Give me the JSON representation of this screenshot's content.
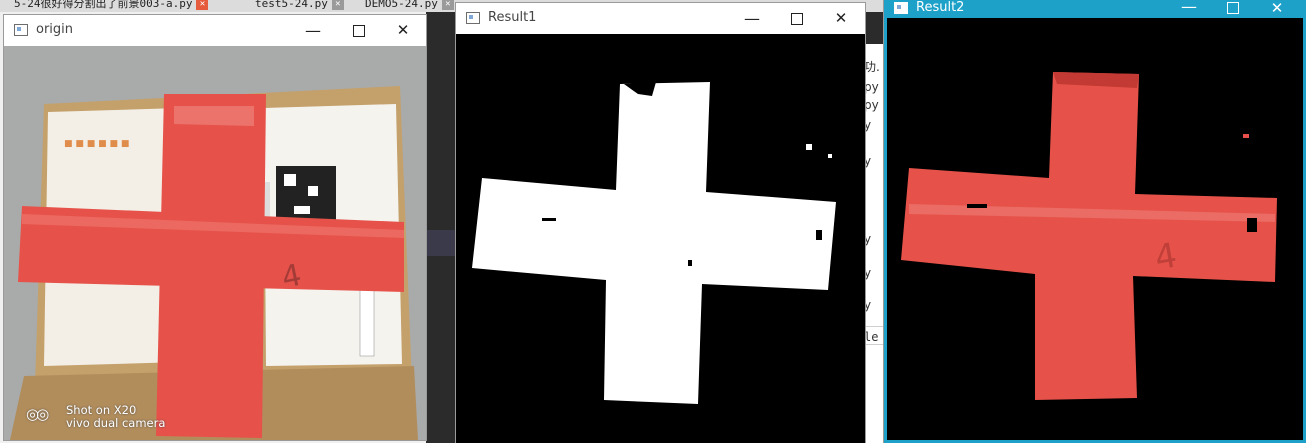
{
  "tabs": [
    {
      "label": "5-24很好得分割出了前景003-a.py",
      "close": "red"
    },
    {
      "label": "test5-24.py",
      "close": "grey"
    },
    {
      "label": "DEMO5-24.py",
      "close": "grey"
    }
  ],
  "console_fragments": [
    "功.",
    "py",
    "py",
    "y",
    "y",
    "y",
    "y",
    "y",
    "le"
  ],
  "windows": {
    "origin": {
      "title": "origin",
      "watermark_line1": "Shot on X20",
      "watermark_line2": "vivo dual camera"
    },
    "result1": {
      "title": "Result1"
    },
    "result2": {
      "title": "Result2"
    }
  },
  "controls": {
    "minimize": "—",
    "close": "✕"
  },
  "colors": {
    "accent_titlebar": "#1da1c9",
    "tape_red": "#e6524a",
    "mask_white": "#ffffff",
    "background_black": "#000000"
  }
}
